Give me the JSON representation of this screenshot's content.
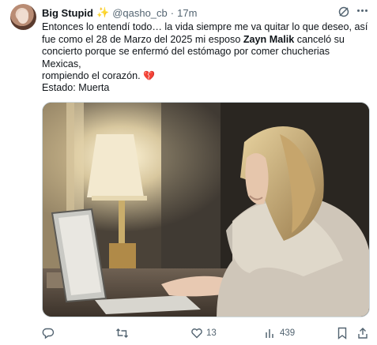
{
  "author": {
    "name": "Big Stupid",
    "badge_icon": "sparkles-icon",
    "handle": "@qasho_cb",
    "separator": "·",
    "time": "17m"
  },
  "tweet": {
    "line1": "Entonces lo entendí todo… la vida siempre me va quitar lo que deseo, así",
    "line2_pre": "fue como el 28 de Marzo del 2025 mi esposo ",
    "line2_bold": "Zayn Malik",
    "line2_post": " canceló su",
    "line3": "concierto porque se enfermó del estómago por comer chucherias Mexicas,",
    "line4": "rompiendo el corazón.",
    "emoji": "💔",
    "status": "Estado: Muerta"
  },
  "actions": {
    "replies": "",
    "retweets": "",
    "likes": "13",
    "views": "439"
  },
  "colors": {
    "text": "#0f1419",
    "muted": "#536471",
    "border": "#cfd9de",
    "badge": "#e6b800"
  }
}
